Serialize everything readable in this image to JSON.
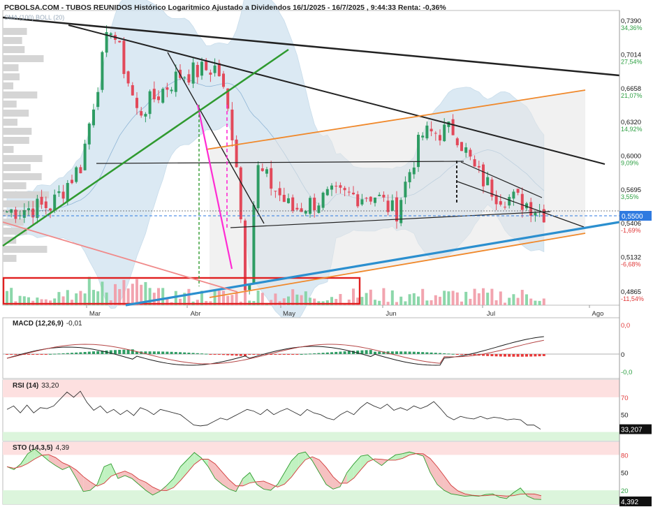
{
  "header": {
    "title": "PCBOLSA.COM - TUBOS REUNIDOS Histórico Logaritmico Ajustado a Dividendos 16/1/2025 - 16/7/2025 , 9:44:33 Renta: -0,36%",
    "overlay_labels": "SMA (100) BOLL (20)"
  },
  "chart_data": [
    {
      "type": "line",
      "name": "price",
      "scale": "log",
      "x_tick_labels": [
        "Mar",
        "Abr",
        "May",
        "Jun",
        "Jul",
        "Ago"
      ],
      "y_ticks": [
        {
          "price": "0,7390",
          "pct": "34,36%"
        },
        {
          "price": "0,7014",
          "pct": "27,54%"
        },
        {
          "price": "0,6658",
          "pct": "21,07%"
        },
        {
          "price": "0,6320",
          "pct": "14,92%"
        },
        {
          "price": "0,6000",
          "pct": "9,09%"
        },
        {
          "price": "0,5695",
          "pct": "3,55%"
        },
        {
          "price": "0,5406",
          "pct": "-1,69%"
        },
        {
          "price": "0,5132",
          "pct": "-6,68%"
        },
        {
          "price": "0,4865",
          "pct": "-11,54%"
        }
      ],
      "last_price_label": "0,5500",
      "ylim": [
        0.47,
        0.75
      ],
      "close_by_month": {
        "dates": [
          "2025-01-16",
          "2025-01-31",
          "2025-02-10",
          "2025-02-20",
          "2025-03-01",
          "2025-03-15",
          "2025-03-28",
          "2025-04-03",
          "2025-04-07",
          "2025-04-10",
          "2025-04-22",
          "2025-05-05",
          "2025-05-20",
          "2025-05-27",
          "2025-06-05",
          "2025-06-16",
          "2025-06-23",
          "2025-06-30",
          "2025-07-10",
          "2025-07-16"
        ],
        "values": [
          0.551,
          0.556,
          0.592,
          0.735,
          0.64,
          0.68,
          0.688,
          0.608,
          0.47,
          0.59,
          0.552,
          0.564,
          0.565,
          0.549,
          0.62,
          0.625,
          0.585,
          0.566,
          0.558,
          0.55
        ]
      }
    },
    {
      "type": "line",
      "name": "MACD",
      "label": "MACD (12,26,9)",
      "value": "-0,01",
      "y_ticks": [
        "0,0",
        "0",
        "-0,0"
      ]
    },
    {
      "type": "line",
      "name": "RSI",
      "label": "RSI (14)",
      "value": "33,20",
      "y_ticks": [
        "70",
        "50"
      ],
      "last_value_label": "33,207",
      "values": [
        56,
        60,
        52,
        61,
        52,
        58,
        57,
        60,
        68,
        76,
        70,
        77,
        64,
        55,
        60,
        52,
        56,
        50,
        55,
        49,
        58,
        55,
        50,
        56,
        54,
        52,
        50,
        44,
        38,
        37,
        38,
        42,
        46,
        44,
        48,
        52,
        56,
        54,
        50,
        56,
        50,
        54,
        57,
        53,
        49,
        56,
        52,
        50,
        46,
        44,
        50,
        54,
        50,
        58,
        64,
        60,
        57,
        62,
        55,
        58,
        55,
        60,
        57,
        60,
        65,
        57,
        48,
        44,
        48,
        46,
        45,
        48,
        45,
        47,
        46,
        44,
        45,
        44,
        38,
        38,
        33.2
      ]
    },
    {
      "type": "line",
      "name": "STO",
      "label": "STO (14,3,5)",
      "value": "4,39",
      "y_ticks": [
        "80",
        "50",
        "20"
      ],
      "last_value_label": "4,392",
      "k_values": [
        60,
        55,
        65,
        82,
        90,
        80,
        70,
        62,
        55,
        60,
        40,
        18,
        20,
        30,
        60,
        65,
        40,
        45,
        40,
        30,
        20,
        12,
        18,
        28,
        40,
        60,
        72,
        84,
        75,
        60,
        40,
        30,
        22,
        18,
        40,
        50,
        30,
        22,
        20,
        30,
        50,
        70,
        82,
        85,
        70,
        50,
        30,
        22,
        26,
        50,
        65,
        78,
        80,
        70,
        62,
        72,
        80,
        82,
        85,
        82,
        78,
        50,
        30,
        20,
        14,
        12,
        10,
        11,
        10,
        13,
        14,
        8,
        6,
        16,
        24,
        10,
        5,
        4.39
      ]
    }
  ],
  "colors": {
    "bull": "#2e9c63",
    "bear": "#e2495a",
    "boll_fill": "#cfe2ef",
    "level": "#2f7ae0",
    "trend_black": "#222222",
    "trend_green": "#2f9a2f",
    "trend_orange": "#f0882a",
    "trend_blue": "#2b8fcf",
    "magenta": "#ff2bd3",
    "red_box": "#e02020",
    "macd_pos": "#2e9c63",
    "macd_neg": "#e83a3a"
  }
}
